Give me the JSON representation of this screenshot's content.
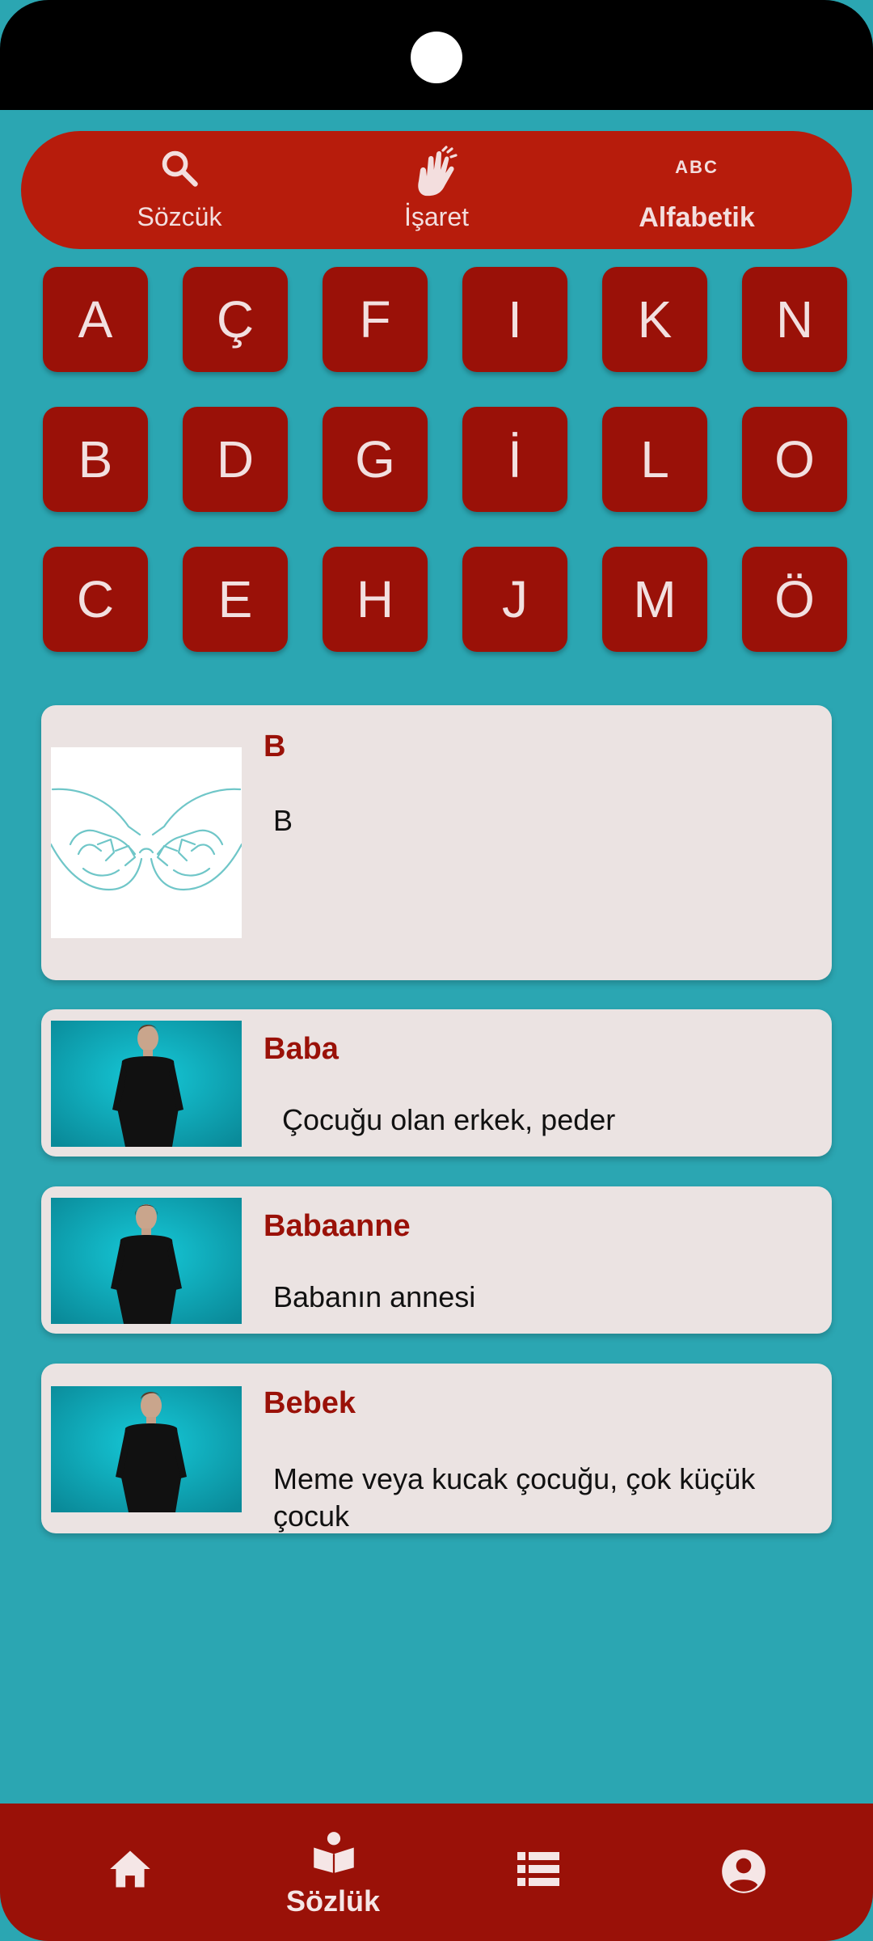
{
  "top_tabs": [
    {
      "label": "Sözcük",
      "icon": "search-icon",
      "active": false
    },
    {
      "label": "İşaret",
      "icon": "hand-sign-icon",
      "active": false
    },
    {
      "label": "Alfabetik",
      "icon": "abc-icon",
      "icon_text": "ABC",
      "active": true
    }
  ],
  "letters": [
    "A",
    "Ç",
    "F",
    "I",
    "K",
    "N",
    "B",
    "D",
    "G",
    "İ",
    "L",
    "O",
    "C",
    "E",
    "H",
    "J",
    "M",
    "Ö"
  ],
  "results": [
    {
      "title": "B",
      "description": "B",
      "thumbnail": "hand-sign-illustration"
    },
    {
      "title": "Baba",
      "description": "Çocuğu olan erkek, peder",
      "thumbnail": "signer-video"
    },
    {
      "title": "Babaanne",
      "description": "Babanın annesi",
      "thumbnail": "signer-video"
    },
    {
      "title": "Bebek",
      "description": "Meme veya kucak çocuğu, çok küçük çocuk",
      "thumbnail": "signer-video"
    }
  ],
  "bottom_nav": [
    {
      "label": "",
      "icon": "home-icon"
    },
    {
      "label": "Sözlük",
      "icon": "dictionary-icon",
      "active": true
    },
    {
      "label": "",
      "icon": "list-icon"
    },
    {
      "label": "",
      "icon": "profile-icon"
    }
  ],
  "colors": {
    "background": "#2ba6b2",
    "primary": "#b71c0c",
    "button": "#9a1108",
    "card": "#ebe3e2",
    "title": "#9a1108"
  }
}
